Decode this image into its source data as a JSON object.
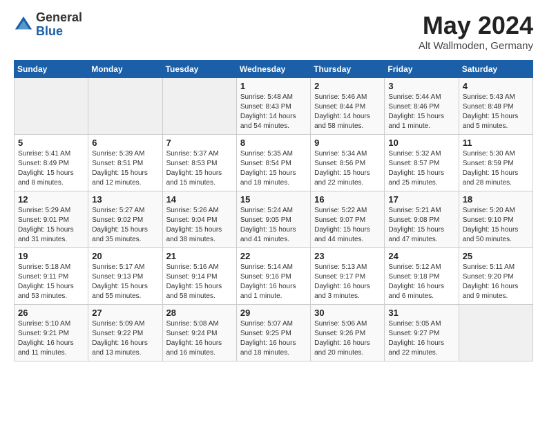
{
  "logo": {
    "general": "General",
    "blue": "Blue"
  },
  "title": {
    "month_year": "May 2024",
    "location": "Alt Wallmoden, Germany"
  },
  "weekdays": [
    "Sunday",
    "Monday",
    "Tuesday",
    "Wednesday",
    "Thursday",
    "Friday",
    "Saturday"
  ],
  "weeks": [
    [
      {
        "day": "",
        "info": ""
      },
      {
        "day": "",
        "info": ""
      },
      {
        "day": "",
        "info": ""
      },
      {
        "day": "1",
        "info": "Sunrise: 5:48 AM\nSunset: 8:43 PM\nDaylight: 14 hours\nand 54 minutes."
      },
      {
        "day": "2",
        "info": "Sunrise: 5:46 AM\nSunset: 8:44 PM\nDaylight: 14 hours\nand 58 minutes."
      },
      {
        "day": "3",
        "info": "Sunrise: 5:44 AM\nSunset: 8:46 PM\nDaylight: 15 hours\nand 1 minute."
      },
      {
        "day": "4",
        "info": "Sunrise: 5:43 AM\nSunset: 8:48 PM\nDaylight: 15 hours\nand 5 minutes."
      }
    ],
    [
      {
        "day": "5",
        "info": "Sunrise: 5:41 AM\nSunset: 8:49 PM\nDaylight: 15 hours\nand 8 minutes."
      },
      {
        "day": "6",
        "info": "Sunrise: 5:39 AM\nSunset: 8:51 PM\nDaylight: 15 hours\nand 12 minutes."
      },
      {
        "day": "7",
        "info": "Sunrise: 5:37 AM\nSunset: 8:53 PM\nDaylight: 15 hours\nand 15 minutes."
      },
      {
        "day": "8",
        "info": "Sunrise: 5:35 AM\nSunset: 8:54 PM\nDaylight: 15 hours\nand 18 minutes."
      },
      {
        "day": "9",
        "info": "Sunrise: 5:34 AM\nSunset: 8:56 PM\nDaylight: 15 hours\nand 22 minutes."
      },
      {
        "day": "10",
        "info": "Sunrise: 5:32 AM\nSunset: 8:57 PM\nDaylight: 15 hours\nand 25 minutes."
      },
      {
        "day": "11",
        "info": "Sunrise: 5:30 AM\nSunset: 8:59 PM\nDaylight: 15 hours\nand 28 minutes."
      }
    ],
    [
      {
        "day": "12",
        "info": "Sunrise: 5:29 AM\nSunset: 9:01 PM\nDaylight: 15 hours\nand 31 minutes."
      },
      {
        "day": "13",
        "info": "Sunrise: 5:27 AM\nSunset: 9:02 PM\nDaylight: 15 hours\nand 35 minutes."
      },
      {
        "day": "14",
        "info": "Sunrise: 5:26 AM\nSunset: 9:04 PM\nDaylight: 15 hours\nand 38 minutes."
      },
      {
        "day": "15",
        "info": "Sunrise: 5:24 AM\nSunset: 9:05 PM\nDaylight: 15 hours\nand 41 minutes."
      },
      {
        "day": "16",
        "info": "Sunrise: 5:22 AM\nSunset: 9:07 PM\nDaylight: 15 hours\nand 44 minutes."
      },
      {
        "day": "17",
        "info": "Sunrise: 5:21 AM\nSunset: 9:08 PM\nDaylight: 15 hours\nand 47 minutes."
      },
      {
        "day": "18",
        "info": "Sunrise: 5:20 AM\nSunset: 9:10 PM\nDaylight: 15 hours\nand 50 minutes."
      }
    ],
    [
      {
        "day": "19",
        "info": "Sunrise: 5:18 AM\nSunset: 9:11 PM\nDaylight: 15 hours\nand 53 minutes."
      },
      {
        "day": "20",
        "info": "Sunrise: 5:17 AM\nSunset: 9:13 PM\nDaylight: 15 hours\nand 55 minutes."
      },
      {
        "day": "21",
        "info": "Sunrise: 5:16 AM\nSunset: 9:14 PM\nDaylight: 15 hours\nand 58 minutes."
      },
      {
        "day": "22",
        "info": "Sunrise: 5:14 AM\nSunset: 9:16 PM\nDaylight: 16 hours\nand 1 minute."
      },
      {
        "day": "23",
        "info": "Sunrise: 5:13 AM\nSunset: 9:17 PM\nDaylight: 16 hours\nand 3 minutes."
      },
      {
        "day": "24",
        "info": "Sunrise: 5:12 AM\nSunset: 9:18 PM\nDaylight: 16 hours\nand 6 minutes."
      },
      {
        "day": "25",
        "info": "Sunrise: 5:11 AM\nSunset: 9:20 PM\nDaylight: 16 hours\nand 9 minutes."
      }
    ],
    [
      {
        "day": "26",
        "info": "Sunrise: 5:10 AM\nSunset: 9:21 PM\nDaylight: 16 hours\nand 11 minutes."
      },
      {
        "day": "27",
        "info": "Sunrise: 5:09 AM\nSunset: 9:22 PM\nDaylight: 16 hours\nand 13 minutes."
      },
      {
        "day": "28",
        "info": "Sunrise: 5:08 AM\nSunset: 9:24 PM\nDaylight: 16 hours\nand 16 minutes."
      },
      {
        "day": "29",
        "info": "Sunrise: 5:07 AM\nSunset: 9:25 PM\nDaylight: 16 hours\nand 18 minutes."
      },
      {
        "day": "30",
        "info": "Sunrise: 5:06 AM\nSunset: 9:26 PM\nDaylight: 16 hours\nand 20 minutes."
      },
      {
        "day": "31",
        "info": "Sunrise: 5:05 AM\nSunset: 9:27 PM\nDaylight: 16 hours\nand 22 minutes."
      },
      {
        "day": "",
        "info": ""
      }
    ]
  ]
}
